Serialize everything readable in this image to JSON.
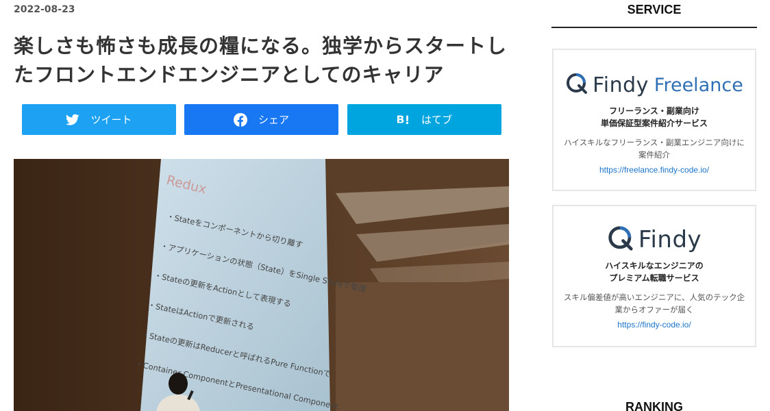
{
  "article": {
    "date": "2022-08-23",
    "title": "楽しさも怖さも成長の糧になる。独学からスタートしたフロントエンドエンジニアとしてのキャリア"
  },
  "share": {
    "tweet_label": "ツイート",
    "share_label": "シェア",
    "hatebu_label": "はてブ",
    "colors": {
      "twitter": "#1da1f2",
      "facebook": "#1877f2",
      "hatena": "#00a4de"
    },
    "icons": [
      "twitter-icon",
      "facebook-icon",
      "hatena-bookmark-icon"
    ]
  },
  "hero": {
    "slide_title": "Redux",
    "bullets": [
      "・Stateをコンポーネントから切り離す",
      "・アプリケーションの状態（State）をSingle Storeで管理",
      "・Stateの更新をActionとして表現する",
      "・StateはActionで更新される",
      "・Stateの更新はReducerと呼ばれるPure Functionで",
      "・Container ComponentとPresentational Component"
    ]
  },
  "sidebar": {
    "service_heading": "SERVICE",
    "ranking_heading": "RANKING",
    "cards": [
      {
        "logo_main": "Findy",
        "logo_sub": "Freelance",
        "tagline_1": "フリーランス・副業向け",
        "tagline_2": "単価保証型案件紹介サービス",
        "desc": "ハイスキルなフリーランス・副業エンジニア向けに案件紹介",
        "url": "https://freelance.findy-code.io/"
      },
      {
        "logo_main": "Findy",
        "tagline_1": "ハイスキルなエンジニアの",
        "tagline_2": "プレミアム転職サービス",
        "desc": "スキル偏差値が高いエンジニアに、人気のテック企業からオファーが届く",
        "url": "https://findy-code.io/"
      }
    ]
  }
}
